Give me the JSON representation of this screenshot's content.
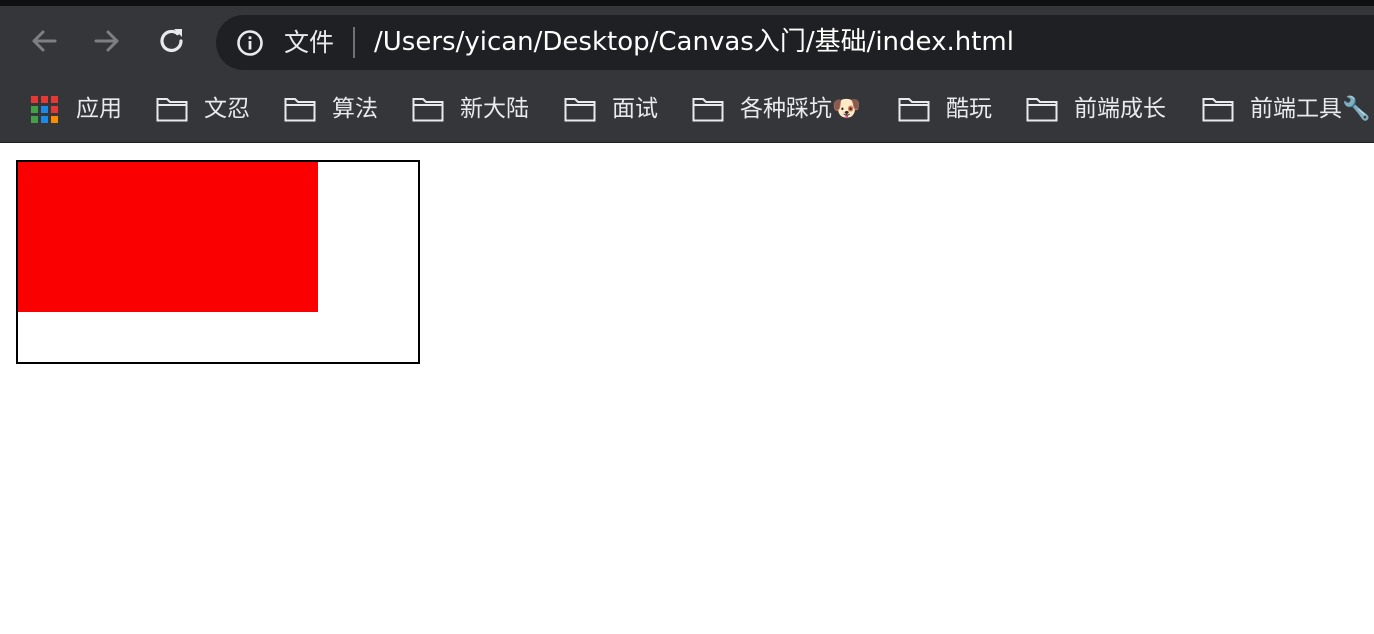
{
  "colors": {
    "toolbar_bg": "#35363a",
    "omnibox_bg": "#1f2023",
    "text": "#e8eaed",
    "canvas_fill": "#fa0000",
    "canvas_border": "#000000"
  },
  "toolbar": {
    "back_icon": "arrow-left-icon",
    "forward_icon": "arrow-right-icon",
    "reload_icon": "reload-icon"
  },
  "omnibox": {
    "info_icon": "info-icon",
    "label": "文件",
    "url": "/Users/yican/Desktop/Canvas入门/基础/index.html"
  },
  "bookmarks": {
    "apps_label": "应用",
    "items": [
      {
        "label": "文忍"
      },
      {
        "label": "算法"
      },
      {
        "label": "新大陆"
      },
      {
        "label": "面试"
      },
      {
        "label": "各种踩坑🐶"
      },
      {
        "label": "酷玩"
      },
      {
        "label": "前端成长"
      },
      {
        "label": "前端工具🔧"
      }
    ]
  }
}
